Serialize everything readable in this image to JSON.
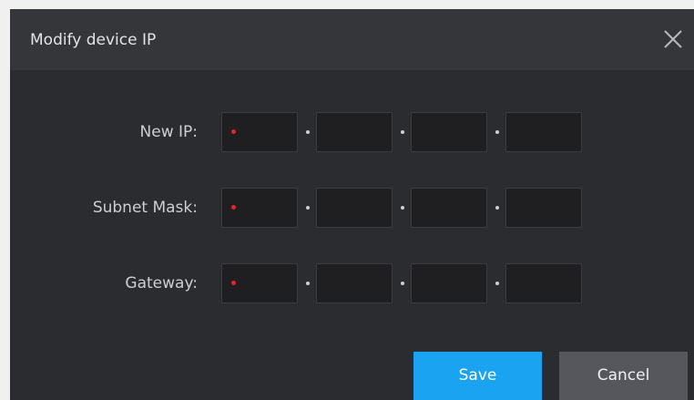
{
  "dialog": {
    "title": "Modify device IP",
    "close_icon": "close-icon"
  },
  "fields": [
    {
      "label": "New IP:",
      "octets": [
        "",
        "",
        "",
        ""
      ],
      "required": true
    },
    {
      "label": "Subnet Mask:",
      "octets": [
        "",
        "",
        "",
        ""
      ],
      "required": true
    },
    {
      "label": "Gateway:",
      "octets": [
        "",
        "",
        "",
        ""
      ],
      "required": true
    }
  ],
  "buttons": {
    "save_label": "Save",
    "cancel_label": "Cancel"
  },
  "colors": {
    "accent": "#1aa3f0",
    "required_marker": "#e0262b",
    "dialog_bg": "#2b2c30",
    "title_bg": "#35363a"
  }
}
